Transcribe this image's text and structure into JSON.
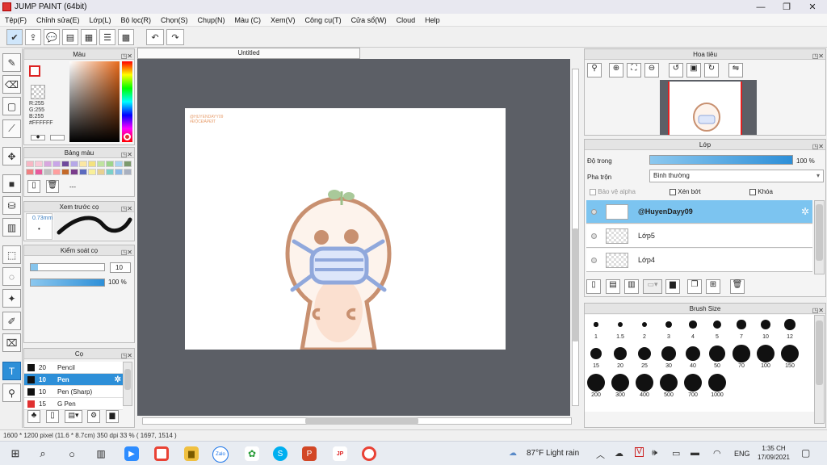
{
  "window": {
    "title": "JUMP PAINT (64bit)",
    "min": "—",
    "restore": "❐",
    "close": "✕"
  },
  "menu": [
    "Tệp(F)",
    "Chỉnh sửa(E)",
    "Lớp(L)",
    "Bộ lọc(R)",
    "Chọn(S)",
    "Chụp(N)",
    "Màu (C)",
    "Xem(V)",
    "Công cụ(T)",
    "Cửa sổ(W)",
    "Cloud",
    "Help"
  ],
  "document": {
    "tab": "Untitled",
    "signature": "@HUYENDAYY09",
    "signature2": "#ĐỘCĐÁPĐÍT"
  },
  "color_panel": {
    "title": "Màu",
    "r": "R:255",
    "g": "G:255",
    "b": "B:255",
    "hex": "#FFFFFF"
  },
  "palette_panel": {
    "title": "Bảng màu",
    "dash": "---",
    "swatches": [
      "#f7b7c4",
      "#f9c8d6",
      "#d8a7df",
      "#c9a6e8",
      "#6f4a9c",
      "#b6a8e8",
      "#fbe7a3",
      "#f4e27f",
      "#bfe3a0",
      "#9dd48a",
      "#a9d3f2",
      "#7c9a6d",
      "#f08080",
      "#e85a9c",
      "#c0c0c0",
      "#ff9f9f",
      "#c46a2a",
      "#7a3d8c",
      "#5c6bbf",
      "#f9f09a",
      "#e8d090",
      "#7bd0c8",
      "#8bb8e8",
      "#a8b0c0"
    ]
  },
  "preview_panel": {
    "title": "Xem trước cọ",
    "size": "0.73mm"
  },
  "brush_control": {
    "title": "Kiểm soát cọ",
    "size_value": "10",
    "opacity_value": "100 %",
    "size_fill": 0.1,
    "opacity_fill": 1.0
  },
  "brush_list": {
    "title": "Cọ",
    "items": [
      {
        "size": "20",
        "name": "Pencil",
        "color": "#111111"
      },
      {
        "size": "10",
        "name": "Pen",
        "color": "#111111"
      },
      {
        "size": "10",
        "name": "Pen (Sharp)",
        "color": "#111111"
      },
      {
        "size": "15",
        "name": "G Pen",
        "color": "#e03030"
      }
    ]
  },
  "navigator": {
    "title": "Hoa tiêu"
  },
  "layer_panel": {
    "title": "Lớp",
    "opacity_label": "Độ trong",
    "opacity_value": "100 %",
    "opacity_fill": 1.0,
    "blend_label": "Pha trộn",
    "blend_value": "Bình thường",
    "protect_alpha": "Bảo vệ alpha",
    "clip": "Xén bớt",
    "lock": "Khóa",
    "layers": [
      {
        "name": "@HuyenDayy09"
      },
      {
        "name": "Lớp5"
      },
      {
        "name": "Lớp4"
      }
    ]
  },
  "brush_size_panel": {
    "title": "Brush Size",
    "sizes": [
      "1",
      "1.5",
      "2",
      "3",
      "4",
      "5",
      "7",
      "10",
      "12",
      "15",
      "20",
      "25",
      "30",
      "40",
      "50",
      "70",
      "100",
      "150",
      "200",
      "300",
      "400",
      "500",
      "700",
      "1000"
    ]
  },
  "status": {
    "text": "1600 * 1200 pixel   (11.6 * 8.7cm)   350 dpi   33 %   ( 1697, 1514 )"
  },
  "taskbar": {
    "weather": "87°F  Light rain",
    "lang": "ENG",
    "time": "1:35 CH",
    "date": "17/09/2021",
    "zalo": "Zalo"
  }
}
